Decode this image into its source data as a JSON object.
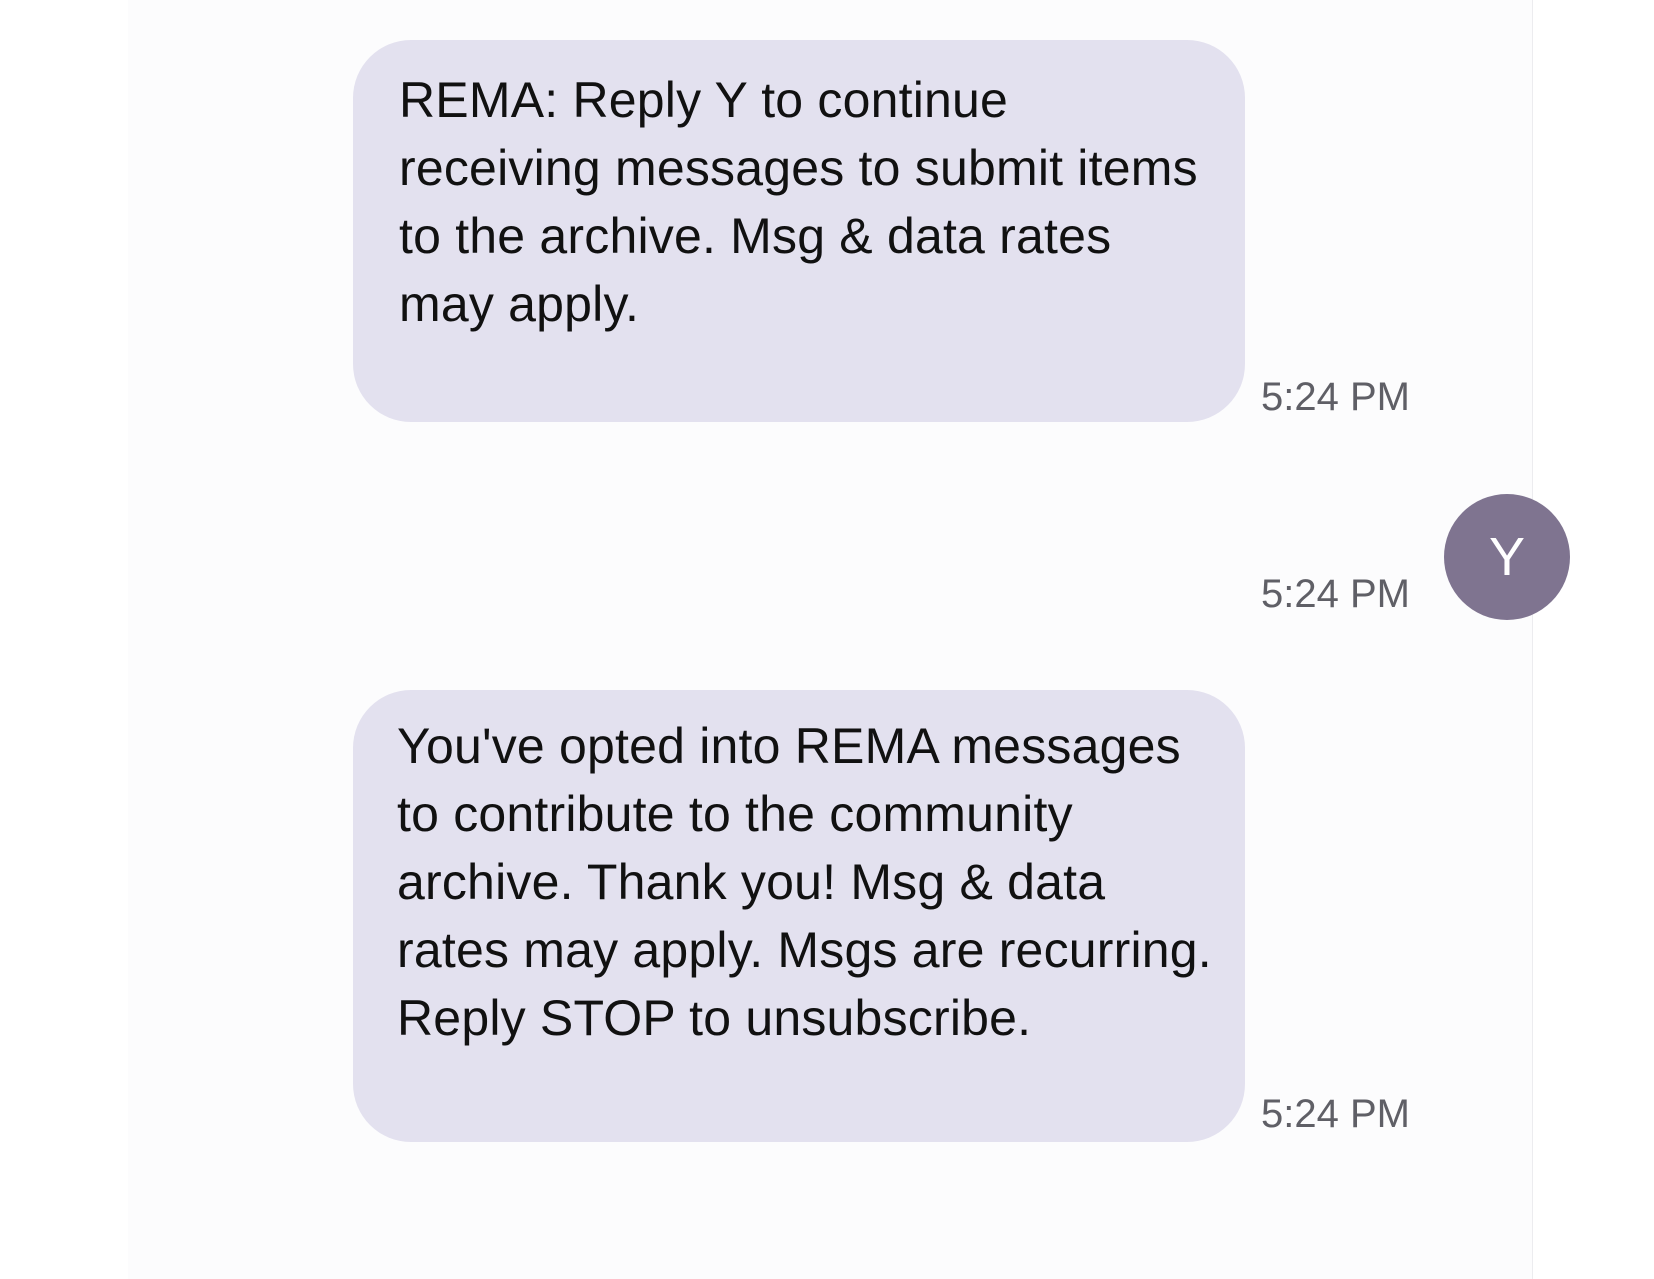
{
  "conversation": {
    "messages": [
      {
        "text": "REMA: Reply Y to continue receiving messages to submit items to the archive. Msg & data rates may apply.",
        "time": "5:24 PM"
      },
      {
        "sender_initial": "Y",
        "time": "5:24 PM"
      },
      {
        "text": "You've opted into REMA messages to contribute to the community archive. Thank you! Msg & data rates may apply. Msgs are recurring. Reply STOP to unsubscribe.",
        "time": "5:24 PM"
      }
    ]
  },
  "colors": {
    "bubble_background": "#e3e1ef",
    "avatar_background": "#7f7490",
    "timestamp_text": "#5f5f66"
  }
}
